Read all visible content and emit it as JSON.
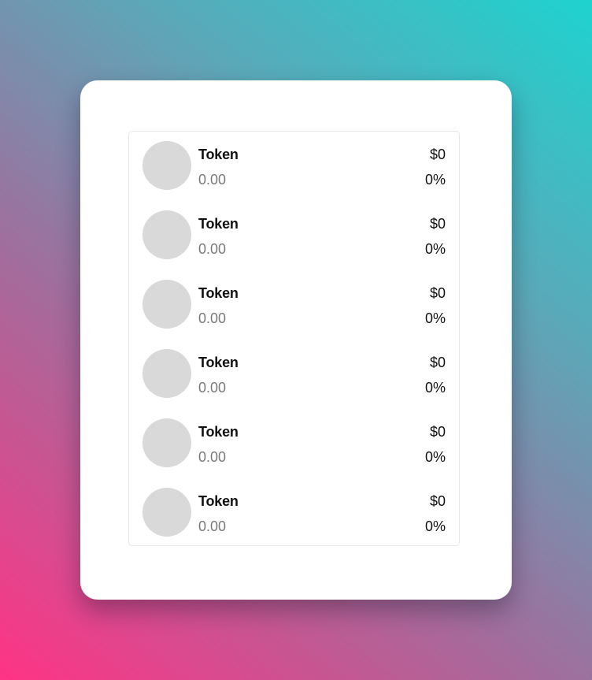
{
  "colors": {
    "gradient_top_right": "#1ed3cf",
    "gradient_bottom_left": "#ff3385",
    "card_background": "#ffffff",
    "avatar_placeholder": "#d9d9d9",
    "muted_text": "#7a7a7a"
  },
  "tokens": [
    {
      "name": "Token",
      "amount": "0.00",
      "value": "$0",
      "change": "0%"
    },
    {
      "name": "Token",
      "amount": "0.00",
      "value": "$0",
      "change": "0%"
    },
    {
      "name": "Token",
      "amount": "0.00",
      "value": "$0",
      "change": "0%"
    },
    {
      "name": "Token",
      "amount": "0.00",
      "value": "$0",
      "change": "0%"
    },
    {
      "name": "Token",
      "amount": "0.00",
      "value": "$0",
      "change": "0%"
    },
    {
      "name": "Token",
      "amount": "0.00",
      "value": "$0",
      "change": "0%"
    }
  ]
}
